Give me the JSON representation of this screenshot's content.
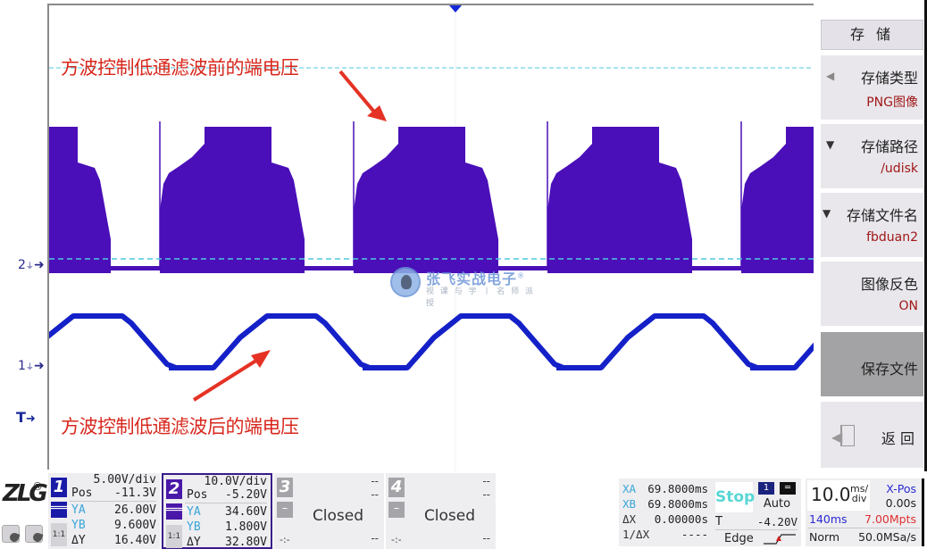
{
  "scope": {
    "channel_markers": [
      {
        "label": "2",
        "ground_symbol": "⏚",
        "arrow": "➜"
      },
      {
        "label": "1",
        "ground_symbol": "⏚",
        "arrow": "➜"
      }
    ],
    "trigger_marker": {
      "label": "T",
      "arrow": "➜"
    },
    "annotations": {
      "top": "方波控制低通滤波前的端电压",
      "bottom": "方波控制低通滤波后的端电压"
    },
    "colors": {
      "ch2_trace": "#4a0fb8",
      "ch1_trace": "#1420c8",
      "cursor_line": "#4fc8e0",
      "annotation": "#d8281e",
      "trigger_pos": "#1428d8"
    }
  },
  "watermark": {
    "title": "张飞实战电子",
    "reg": "®",
    "subtitle": "视 课 与 学 丨 名 师 派 授"
  },
  "menu": {
    "title": "存 储",
    "items": [
      {
        "title": "存储类型",
        "value": "PNG图像",
        "icon": "◀"
      },
      {
        "title": "存储路径",
        "value": "/udisk",
        "icon": "▼"
      },
      {
        "title": "存储文件名",
        "value": "fbduan2",
        "icon": "▼"
      },
      {
        "title": "图像反色",
        "value": "ON",
        "icon": ""
      },
      {
        "title": "保存文件",
        "value": "",
        "icon": ""
      },
      {
        "title": "返 回",
        "value": "",
        "icon": "back-arrow"
      }
    ]
  },
  "bottom": {
    "brand": "ZLG",
    "brand_reg": "®",
    "channels": [
      {
        "num": "1",
        "color": "#1a1aa8",
        "scale": "5.00V/div",
        "rows": [
          {
            "label": "Pos",
            "value": "-11.3V"
          },
          {
            "label": "YA",
            "value": "26.00V"
          },
          {
            "label": "YB",
            "value": "9.600V"
          },
          {
            "label": "ΔY",
            "value": "16.40V"
          }
        ],
        "coupling": "═══",
        "ratio": "1:1"
      },
      {
        "num": "2",
        "color": "#4a18a8",
        "scale": "10.0V/div",
        "rows": [
          {
            "label": "Pos",
            "value": "-5.20V"
          },
          {
            "label": "YA",
            "value": "34.60V"
          },
          {
            "label": "YB",
            "value": "1.800V"
          },
          {
            "label": "ΔY",
            "value": "32.80V"
          }
        ],
        "coupling": "═══",
        "ratio": "1:1"
      },
      {
        "num": "3",
        "top1": "--",
        "top2": "--",
        "state": "Closed",
        "bl": "-:-",
        "br": "--",
        "coupling": "–"
      },
      {
        "num": "4",
        "top1": "--",
        "top2": "--",
        "state": "Closed",
        "bl": "-:-",
        "br": "--",
        "coupling": "–"
      }
    ],
    "cursors": [
      {
        "label": "XA",
        "value": "69.8000ms"
      },
      {
        "label": "XB",
        "value": "69.8000ms"
      },
      {
        "label": "ΔX",
        "value": "0.00000s"
      },
      {
        "label": "1/ΔX",
        "value": "----"
      }
    ],
    "trigger": {
      "run_state": "Stop",
      "source": "1",
      "coupling": "═",
      "mode": "Auto",
      "level_label": "T",
      "level_value": "-4.20V",
      "type": "Edge"
    },
    "timebase": {
      "value": "10.0",
      "unit_top": "ms/",
      "unit_bottom": "div",
      "xpos_label": "X-Pos",
      "xpos_value": "0.00s",
      "window": "140ms",
      "memory": "7.00Mpts",
      "acq_mode": "Norm",
      "sample_rate": "50.0MSa/s"
    }
  }
}
